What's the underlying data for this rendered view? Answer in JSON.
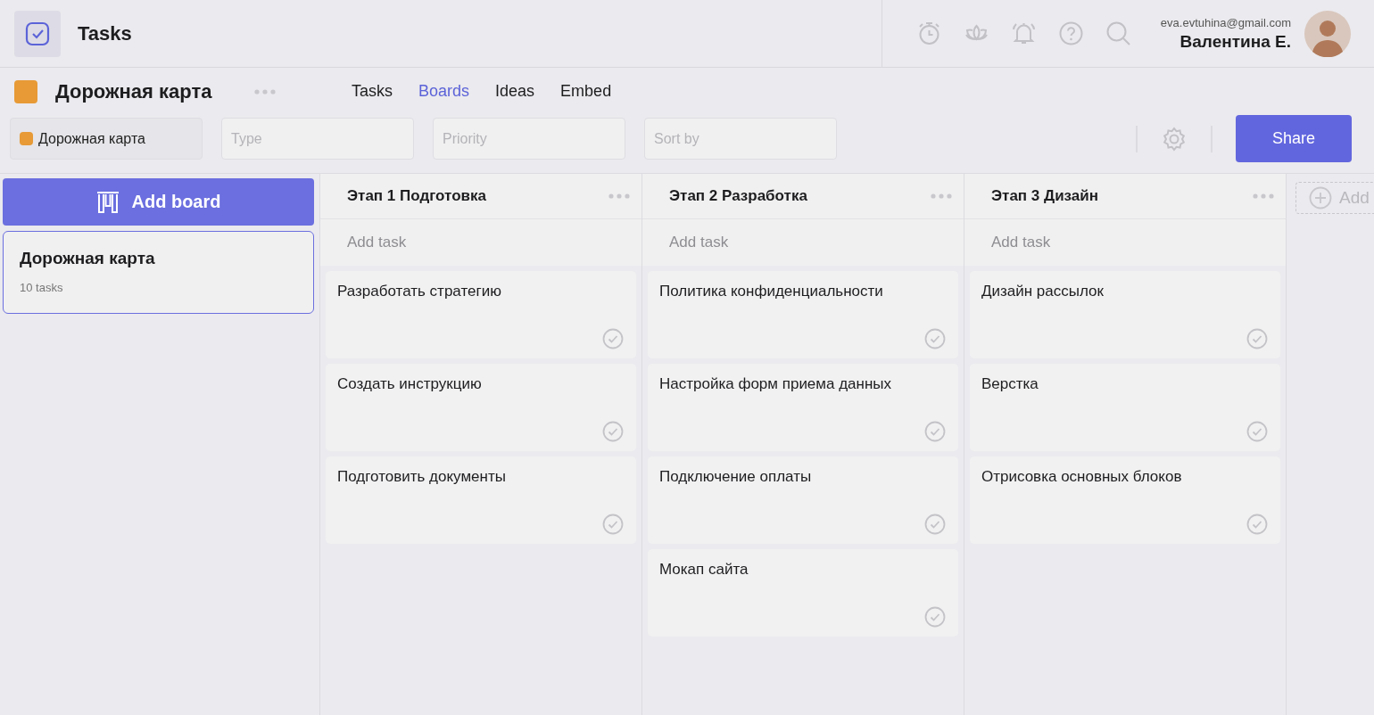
{
  "app": {
    "title": "Tasks"
  },
  "user": {
    "email": "eva.evtuhina@gmail.com",
    "name": "Валентина Е."
  },
  "project": {
    "title": "Дорожная карта"
  },
  "tabs": [
    {
      "label": "Tasks",
      "selected": false
    },
    {
      "label": "Boards",
      "selected": true
    },
    {
      "label": "Ideas",
      "selected": false
    },
    {
      "label": "Embed",
      "selected": false
    }
  ],
  "filters": [
    {
      "value": "Дорожная карта"
    },
    {
      "placeholder": "Type"
    },
    {
      "placeholder": "Priority"
    },
    {
      "placeholder": "Sort by"
    }
  ],
  "share_button": "Share",
  "add_board_button": "Add board",
  "boards": [
    {
      "title": "Дорожная карта",
      "count": "10 tasks",
      "selected": true
    }
  ],
  "columns": [
    {
      "title": "Этап 1 Подготовка",
      "add_task_placeholder": "Add task",
      "tasks": [
        {
          "title": "Разработать стратегию"
        },
        {
          "title": "Создать инструкцию"
        },
        {
          "title": "Подготовить документы"
        }
      ]
    },
    {
      "title": "Этап 2 Разработка",
      "add_task_placeholder": "Add task",
      "tasks": [
        {
          "title": "Политика конфиденциальности"
        },
        {
          "title": "Настройка форм приема данных"
        },
        {
          "title": "Подключение оплаты"
        },
        {
          "title": "Мокап сайта"
        }
      ]
    },
    {
      "title": "Этап 3 Дизайн",
      "add_task_placeholder": "Add task",
      "tasks": [
        {
          "title": "Дизайн рассылок"
        },
        {
          "title": "Верстка"
        },
        {
          "title": "Отрисовка основных блоков"
        }
      ]
    }
  ],
  "add_column_button": "Add"
}
